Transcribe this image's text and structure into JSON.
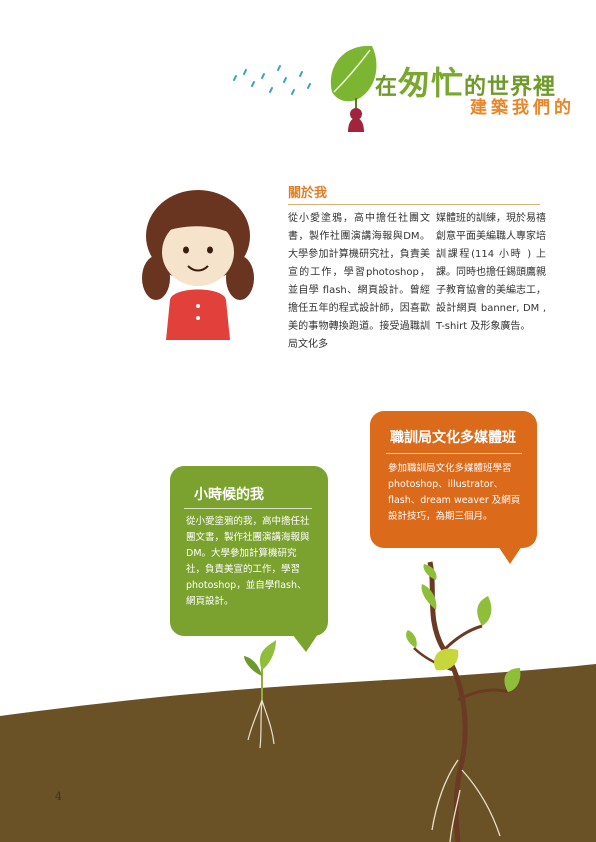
{
  "header": {
    "title_prefix": "在",
    "title_emphasis": "匆忙",
    "title_suffix": "的世界裡",
    "subtitle": "建築我們的"
  },
  "about": {
    "heading": "關於我",
    "column1": "從小愛塗鴉，高中擔任社團文書，製作社團演講海報與DM。大學參加計算機研究社，負責美宣的工作，學習photoshop，並自學 flash、網頁設計。曾經擔任五年的程式設計師，因喜歡美的事物轉換跑道。接受過職訓局文化多",
    "column2": "媒體班的訓練，現於易禧創意平面美編職人專家培訓課程(114 小時 ) 上課。同時也擔任錫頭鷹親子教育協會的美編志工，設計網頁 banner, DM , T-shirt 及形象廣告。"
  },
  "orange_bubble": {
    "title": "職訓局文化多媒體班",
    "text": "參加職訓局文化多媒體班學習 photoshop、illustrator、flash、dream weaver 及網頁設計技巧，為期三個月。"
  },
  "green_bubble": {
    "title": "小時候的我",
    "text": "從小愛塗鴉的我，高中擔任社團文書，製作社團演講海報與DM。大學參加計算機研究社，負責美宣的工作，學習 photoshop，並自學flash、網頁設計。"
  },
  "footer": {
    "page_number": "4"
  },
  "colors": {
    "accent_green": "#7ba22f",
    "accent_orange": "#dc6a1b",
    "soil_brown": "#6b5226"
  }
}
